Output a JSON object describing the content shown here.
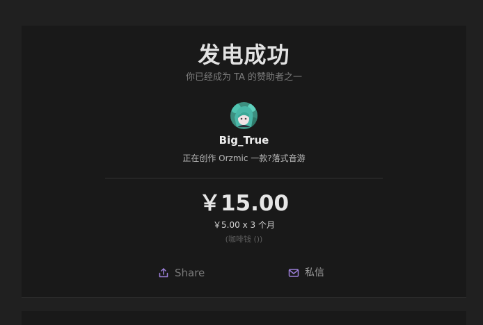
{
  "header": {
    "title": "发电成功",
    "subtitle": "你已经成为 TA 的赞助者之一"
  },
  "creator": {
    "name": "Big_True",
    "bio": "正在创作 Orzmic 一款?落式音游"
  },
  "payment": {
    "amount": "￥15.00",
    "breakdown": "￥5.00 x 3 个月",
    "note": "(咖啡钱 ())"
  },
  "actions": {
    "share_label": "Share",
    "message_label": "私信"
  },
  "colors": {
    "accent": "#9b7fd8",
    "background": "#202020",
    "card": "#191919"
  },
  "icons": {
    "share": "share-icon",
    "message": "mail-icon"
  }
}
